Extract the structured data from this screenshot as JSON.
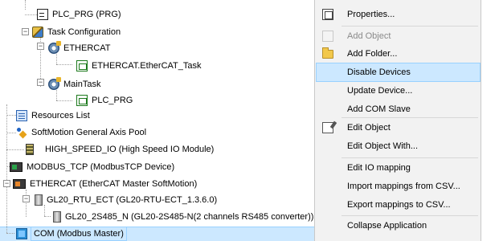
{
  "tree": {
    "items": [
      {
        "label": "PLC_PRG (PRG)",
        "icon": "program-icon"
      },
      {
        "label": "Task Configuration",
        "icon": "task-configuration-icon"
      },
      {
        "label": "ETHERCAT",
        "icon": "task-icon"
      },
      {
        "label": "ETHERCAT.EtherCAT_Task",
        "icon": "task-call-icon"
      },
      {
        "label": "MainTask",
        "icon": "task-icon"
      },
      {
        "label": "PLC_PRG",
        "icon": "task-call-icon"
      },
      {
        "label": "Resources List",
        "icon": "resources-list-icon"
      },
      {
        "label": "SoftMotion General Axis Pool",
        "icon": "axis-pool-icon"
      },
      {
        "label": "HIGH_SPEED_IO (High Speed IO Module)",
        "icon": "io-module-icon"
      },
      {
        "label": "MODBUS_TCP (ModbusTCP Device)",
        "icon": "device-icon"
      },
      {
        "label": "ETHERCAT (EtherCAT Master SoftMotion)",
        "icon": "device-icon"
      },
      {
        "label": "GL20_RTU_ECT (GL20-RTU-ECT_1.3.6.0)",
        "icon": "module-icon"
      },
      {
        "label": "GL20_2S485_N (GL20-2S485-N(2 channels RS485 converter))",
        "icon": "module-icon"
      },
      {
        "label": "COM (Modbus Master)",
        "icon": "com-icon"
      }
    ]
  },
  "context_menu": {
    "items": [
      {
        "label": "Properties...",
        "icon": "properties-icon",
        "enabled": true
      },
      {
        "label": "Add Object",
        "icon": "add-object-icon",
        "enabled": false
      },
      {
        "label": "Add Folder...",
        "icon": "folder-icon",
        "enabled": true
      },
      {
        "label": "Disable Devices",
        "enabled": true,
        "highlighted": true
      },
      {
        "label": "Update Device...",
        "enabled": true
      },
      {
        "label": "Add COM Slave",
        "enabled": true
      },
      {
        "label": "Edit Object",
        "icon": "edit-object-icon",
        "enabled": true
      },
      {
        "label": "Edit Object With...",
        "enabled": true
      },
      {
        "label": "Edit IO mapping",
        "enabled": true
      },
      {
        "label": "Import mappings from CSV...",
        "enabled": true
      },
      {
        "label": "Export mappings to CSV...",
        "enabled": true
      },
      {
        "label": "Collapse Application",
        "enabled": true
      }
    ]
  },
  "colors": {
    "selection": "#cce8ff",
    "selection_border": "#99d1ff",
    "menu_background": "#f2f2f2",
    "disabled_text": "#8a8a8a"
  }
}
